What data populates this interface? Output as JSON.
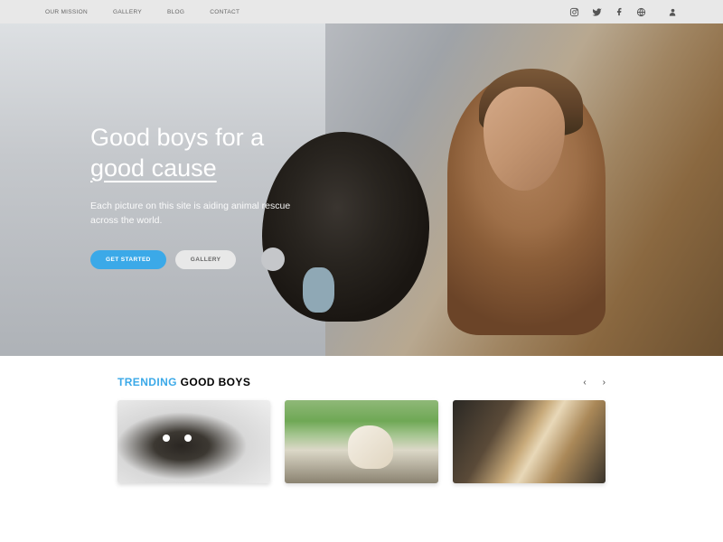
{
  "nav": {
    "items": [
      "OUR MISSION",
      "GALLERY",
      "BLOG",
      "CONTACT"
    ]
  },
  "hero": {
    "title_line1": "Good boys for a",
    "title_line2": "good cause",
    "subtitle": "Each picture on this site is aiding animal rescue across the world.",
    "btn_primary": "GET STARTED",
    "btn_secondary": "GALLERY"
  },
  "trending": {
    "prefix": "TRENDING",
    "rest": " GOOD BOYS"
  }
}
